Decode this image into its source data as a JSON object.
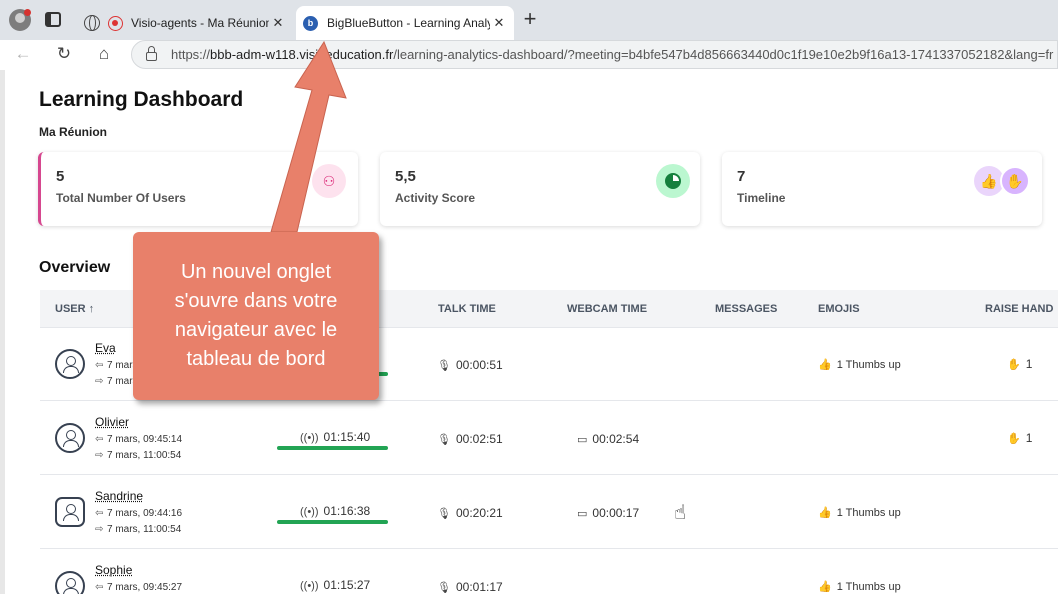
{
  "browser": {
    "tabs": [
      {
        "title": "Visio-agents - Ma Réunion -",
        "icon": "record-icon"
      },
      {
        "title": "BigBlueButton - Learning Analytic",
        "icon": "bbb-icon"
      }
    ],
    "url_prefix": "https://",
    "url_host": "bbb-adm-w118.visioeducation.fr",
    "url_path": "/learning-analytics-dashboard/?meeting=b4bfe547b4d856663440d0c1f19e10e2b9f16a13-1741337052182&lang=fr"
  },
  "dashboard": {
    "title": "Learning Dashboard",
    "meeting_name": "Ma Réunion",
    "cards": [
      {
        "value": "5",
        "label": "Total Number Of Users",
        "accent": "#d6478f"
      },
      {
        "value": "5,5",
        "label": "Activity Score",
        "accent": "#15803d"
      },
      {
        "value": "7",
        "label": "Timeline",
        "accent": "#9333ea"
      }
    ],
    "overview_title": "Overview",
    "columns": {
      "user": "USER ↑",
      "talk_time": "TALK TIME",
      "webcam_time": "WEBCAM TIME",
      "messages": "MESSAGES",
      "emojis": "EMOJIS",
      "raise_hand": "RAISE HAND"
    },
    "rows": [
      {
        "name": "Eva",
        "joined": "7 mars",
        "left": "7 mars",
        "online": "",
        "online_fill": 1,
        "talk": "00:00:51",
        "webcam": "",
        "emoji": "1 Thumbs up",
        "hand": "1",
        "avatar": "round"
      },
      {
        "name": "Olivier",
        "joined": "7 mars, 09:45:14",
        "left": "7 mars, 11:00:54",
        "online": "01:15:40",
        "online_fill": 1,
        "talk": "00:02:51",
        "webcam": "00:02:54",
        "emoji": "",
        "hand": "1",
        "avatar": "round"
      },
      {
        "name": "Sandrine",
        "joined": "7 mars, 09:44:16",
        "left": "7 mars, 11:00:54",
        "online": "01:16:38",
        "online_fill": 1,
        "talk": "00:20:21",
        "webcam": "00:00:17",
        "emoji": "1 Thumbs up",
        "hand": "",
        "avatar": "square"
      },
      {
        "name": "Sophie",
        "joined": "7 mars, 09:45:27",
        "left": "",
        "online": "01:15:27",
        "online_fill": 1,
        "talk": "00:01:17",
        "webcam": "",
        "emoji": "1 Thumbs up",
        "hand": "",
        "avatar": "round"
      }
    ]
  },
  "annotation": {
    "text": "Un nouvel onglet s'ouvre dans votre navigateur avec le tableau de bord",
    "color": "#e8806a"
  }
}
